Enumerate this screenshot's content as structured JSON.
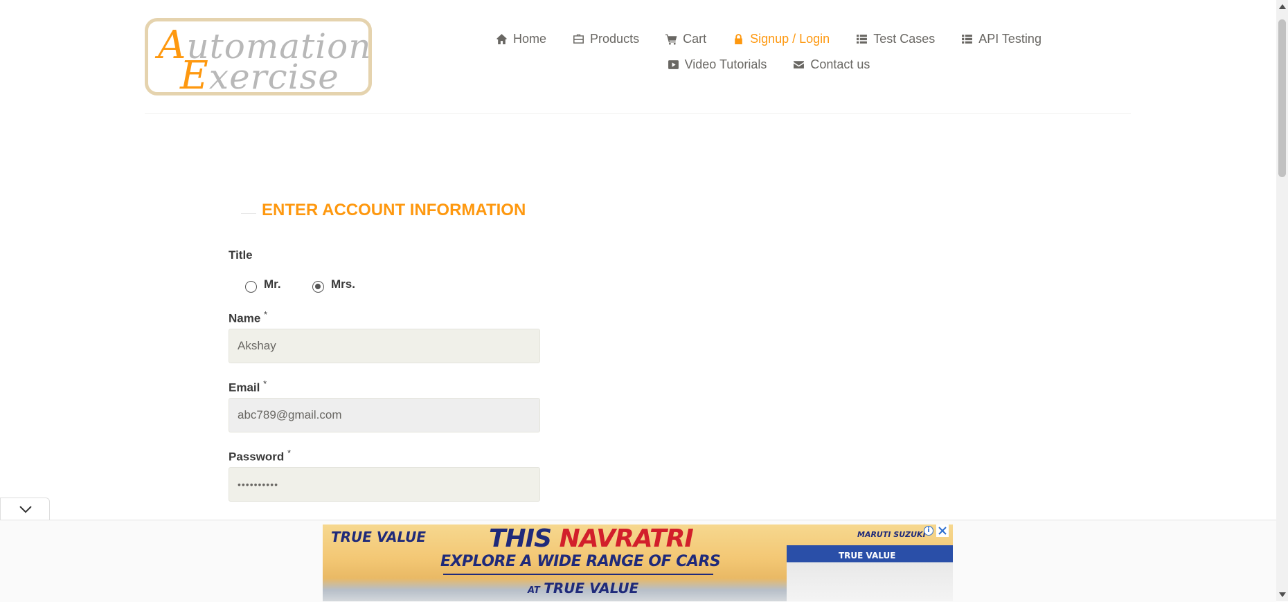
{
  "logo": {
    "line1_cap": "A",
    "line1_rest": "utomation",
    "line2_cap": "E",
    "line2_rest": "xercise"
  },
  "nav": {
    "row1": [
      {
        "label": "Home",
        "icon": "home-icon"
      },
      {
        "label": "Products",
        "icon": "briefcase-icon"
      },
      {
        "label": "Cart",
        "icon": "cart-icon"
      },
      {
        "label": "Signup / Login",
        "icon": "lock-icon",
        "active": true
      },
      {
        "label": "Test Cases",
        "icon": "list-icon"
      },
      {
        "label": "API Testing",
        "icon": "list-icon"
      }
    ],
    "row2": [
      {
        "label": "Video Tutorials",
        "icon": "youtube-play-icon"
      },
      {
        "label": "Contact us",
        "icon": "envelope-icon"
      }
    ]
  },
  "form": {
    "heading": "ENTER ACCOUNT INFORMATION",
    "title_label": "Title",
    "title_options": [
      {
        "label": "Mr.",
        "checked": false
      },
      {
        "label": "Mrs.",
        "checked": true
      }
    ],
    "name_label": "Name",
    "name_value": "Akshay",
    "email_label": "Email",
    "email_value": "abc789@gmail.com",
    "password_label": "Password",
    "password_value": "••••••••••",
    "required_mark": "*"
  },
  "ad": {
    "brand": "TRUE VALUE",
    "headline_part1": "THIS",
    "headline_part2": "NAVRATRI",
    "subline": "EXPLORE A WIDE RANGE OF CARS",
    "at_prefix": "AT",
    "at_brand": "TRUE VALUE",
    "maruti": "MARUTI SUZUKI",
    "showroom_sign": "TRUE VALUE",
    "info_glyph": "i"
  },
  "colors": {
    "accent": "#fe980f",
    "text": "#696763",
    "input_bg": "#f0f0e9"
  }
}
